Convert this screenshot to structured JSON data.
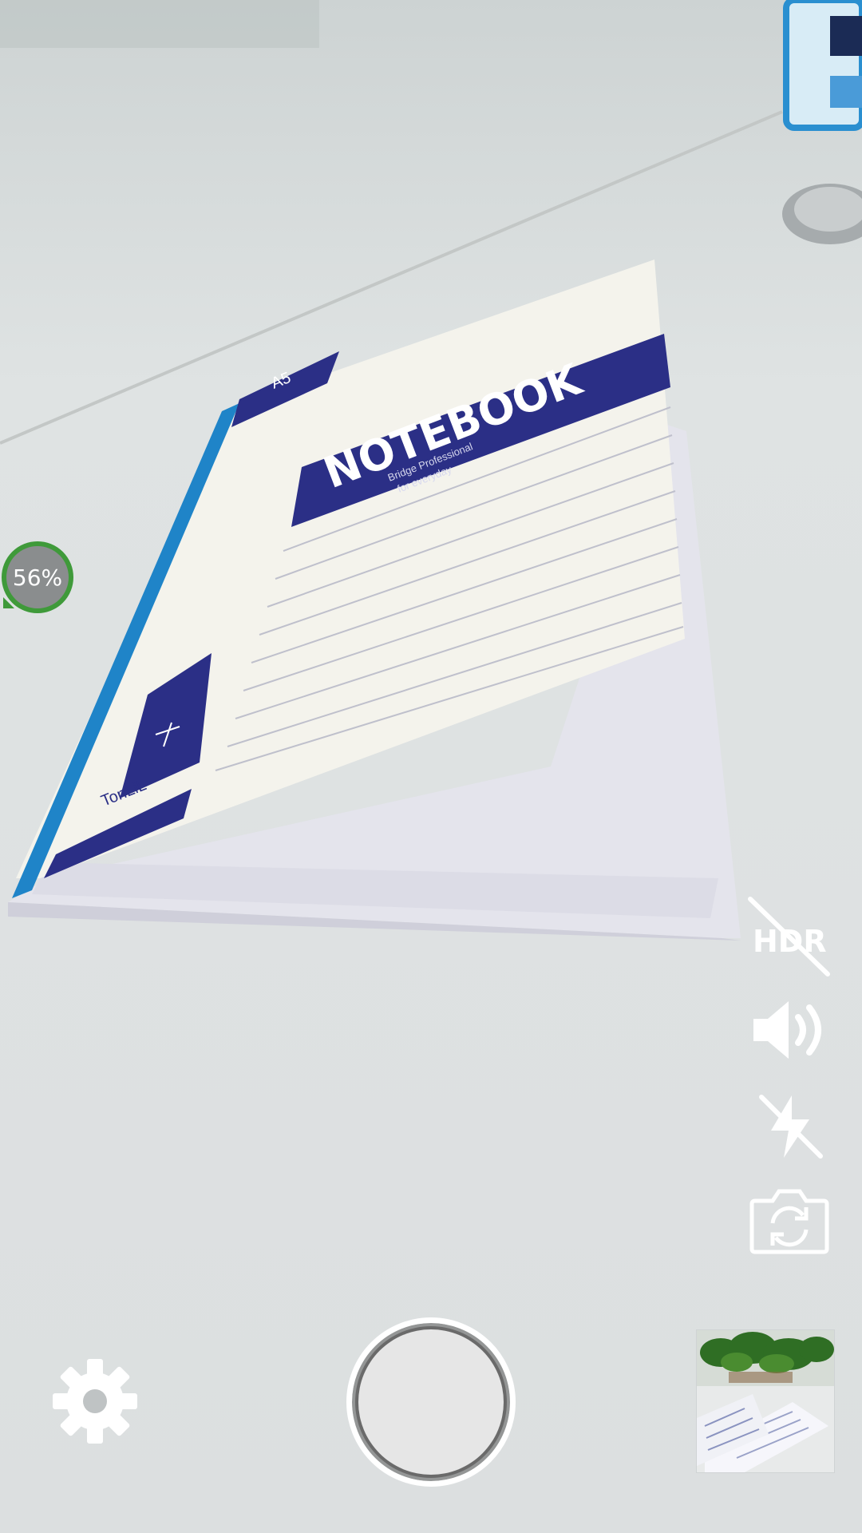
{
  "camera": {
    "zoom_badge": "56%",
    "hdr_label": "HDR",
    "controls": {
      "hdr": {
        "state": "off",
        "icon": "hdr-off-icon"
      },
      "sound": {
        "state": "on",
        "icon": "volume-icon"
      },
      "flash": {
        "state": "off",
        "icon": "flash-off-icon"
      },
      "switch_camera": {
        "icon": "camera-switch-icon"
      },
      "settings": {
        "icon": "gear-icon"
      },
      "shutter": {
        "icon": "shutter-button"
      },
      "gallery": {
        "icon": "gallery-thumbnail"
      }
    }
  },
  "scene": {
    "notebook_title": "NOTEBOOK",
    "notebook_size": "A5",
    "notebook_brand": "TonLiL",
    "notebook_subtitle": "Bridge Professional",
    "notebook_tagline": "for everyday"
  },
  "colors": {
    "badge_ring": "#3f9a3a",
    "notebook_blue": "#2b2f86",
    "spine_blue": "#1f84c8"
  }
}
